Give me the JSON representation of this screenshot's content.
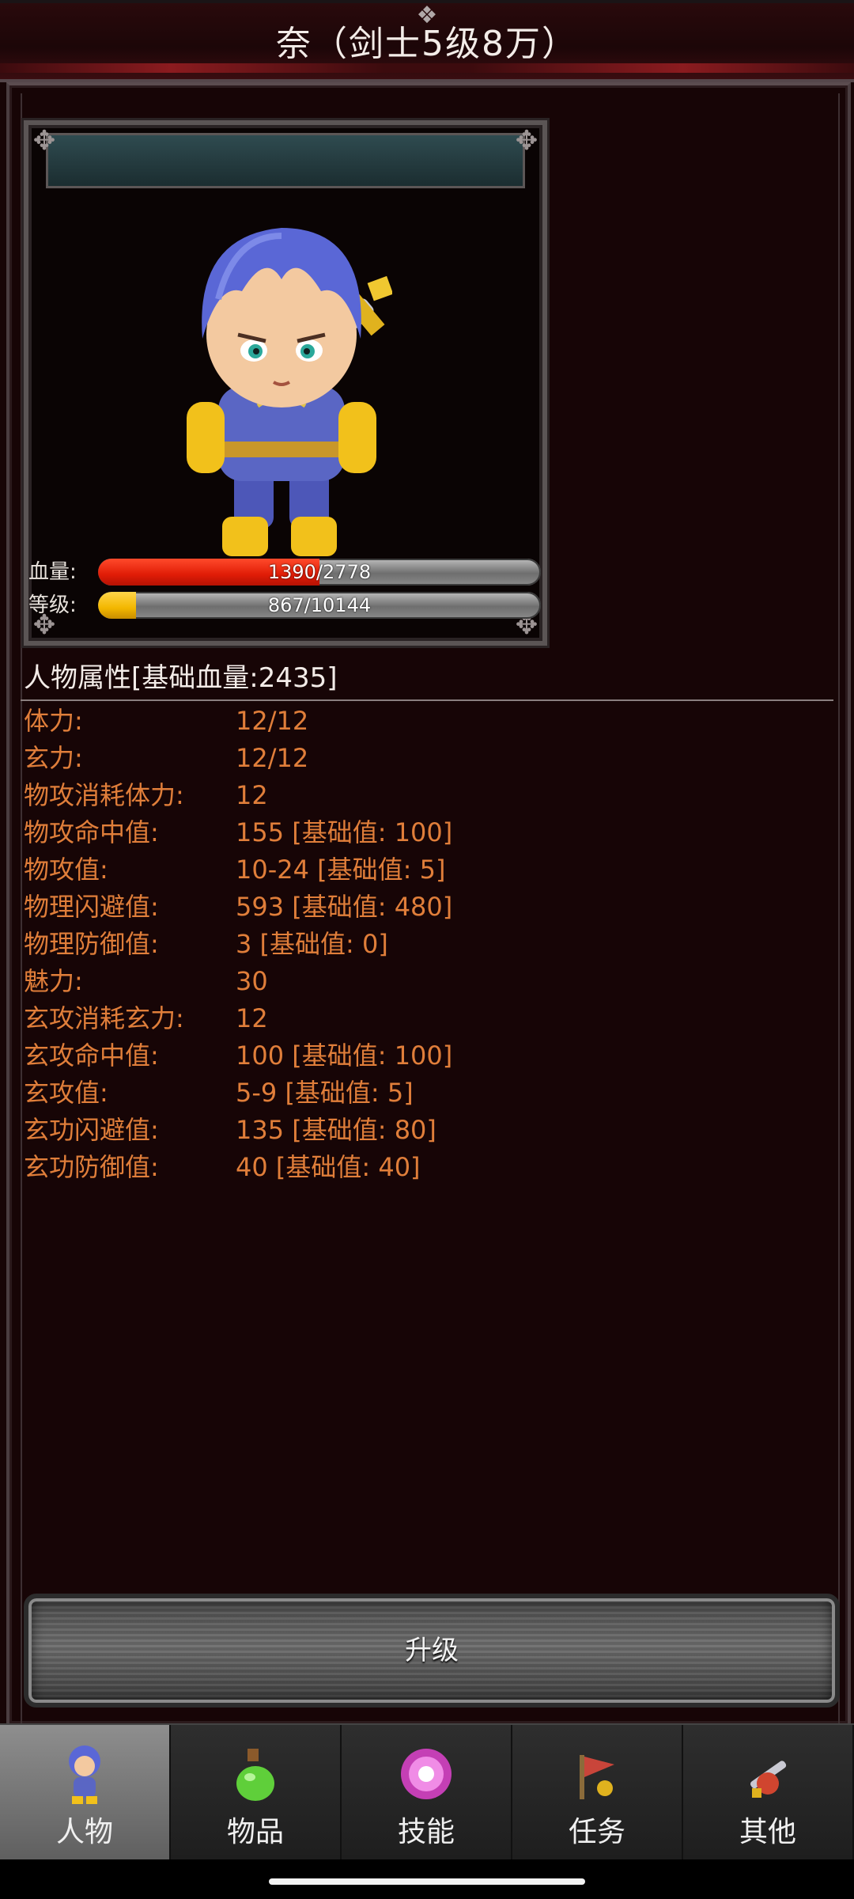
{
  "header": {
    "title": "奈（剑士5级8万）"
  },
  "status": {
    "hp_label": "血量:",
    "hp_value": "1390/2778",
    "hp_fraction": 0.5,
    "level_label": "等级:",
    "level_value": "867/10144",
    "level_fraction": 0.0855
  },
  "attributes": {
    "header": "人物属性[基础血量:2435]",
    "rows": [
      {
        "name": "体力:",
        "value": "12/12"
      },
      {
        "name": "玄力:",
        "value": "12/12"
      },
      {
        "name": "物攻消耗体力:",
        "value": "12"
      },
      {
        "name": "物攻命中值:",
        "value": "155 [基础值: 100]"
      },
      {
        "name": "物攻值:",
        "value": "10-24 [基础值: 5]"
      },
      {
        "name": "物理闪避值:",
        "value": "593 [基础值: 480]"
      },
      {
        "name": "物理防御值:",
        "value": "3 [基础值: 0]"
      },
      {
        "name": "魅力:",
        "value": "30"
      },
      {
        "name": "玄攻消耗玄力:",
        "value": "12"
      },
      {
        "name": "玄攻命中值:",
        "value": "100 [基础值: 100]"
      },
      {
        "name": "玄攻值:",
        "value": "5-9 [基础值: 5]"
      },
      {
        "name": "玄功闪避值:",
        "value": "135 [基础值: 80]"
      },
      {
        "name": "玄功防御值:",
        "value": "40 [基础值: 40]"
      }
    ]
  },
  "actions": {
    "upgrade_label": "升级"
  },
  "nav": {
    "tabs": [
      {
        "label": "人物",
        "icon": "character-icon",
        "active": true
      },
      {
        "label": "物品",
        "icon": "potion-icon",
        "active": false
      },
      {
        "label": "技能",
        "icon": "skill-orb-icon",
        "active": false
      },
      {
        "label": "任务",
        "icon": "quest-flag-icon",
        "active": false
      },
      {
        "label": "其他",
        "icon": "sword-other-icon",
        "active": false
      }
    ]
  },
  "colors": {
    "background": "#170506",
    "attribute_text": "#e07e3a",
    "hp_bar": "#e01c06",
    "level_bar": "#f3b700"
  }
}
